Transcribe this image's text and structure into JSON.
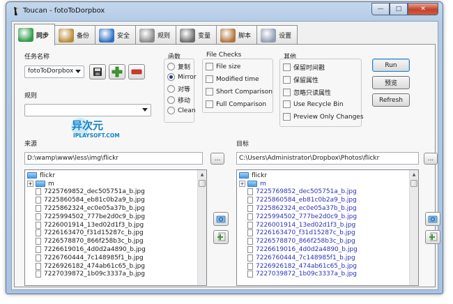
{
  "window": {
    "title": "Toucan - fotoToDorpbox"
  },
  "tabs": [
    {
      "label": "同步",
      "icon": "sync-icon",
      "active": true
    },
    {
      "label": "备份",
      "icon": "backup-box-icon",
      "active": false
    },
    {
      "label": "安全",
      "icon": "security-globe-icon",
      "active": false
    },
    {
      "label": "规则",
      "icon": "rules-document-icon",
      "active": false
    },
    {
      "label": "变量",
      "icon": "variables-tools-icon",
      "active": false
    },
    {
      "label": "脚本",
      "icon": "script-scroll-icon",
      "active": false
    },
    {
      "label": "设置",
      "icon": "settings-gear-icon",
      "active": false
    }
  ],
  "task": {
    "label": "任务名称",
    "value": "fotoToDorpbox"
  },
  "rules": {
    "label": "规则",
    "value": ""
  },
  "function": {
    "label": "函数",
    "options": [
      {
        "label": "复制",
        "selected": false
      },
      {
        "label": "Mirror",
        "selected": true
      },
      {
        "label": "对等",
        "selected": false
      },
      {
        "label": "移动",
        "selected": false
      },
      {
        "label": "Clean",
        "selected": false
      }
    ]
  },
  "file_checks": {
    "label": "File Checks",
    "options": [
      {
        "label": "File size",
        "checked": false
      },
      {
        "label": "Modified time",
        "checked": false
      },
      {
        "label": "Short Comparison",
        "checked": false
      },
      {
        "label": "Full Comparison",
        "checked": false
      }
    ]
  },
  "other": {
    "label": "其他",
    "options": [
      {
        "label": "保留时间戳",
        "checked": false
      },
      {
        "label": "保留属性",
        "checked": false
      },
      {
        "label": "忽略只读属性",
        "checked": false
      },
      {
        "label": "Use Recycle Bin",
        "checked": false
      },
      {
        "label": "Preview Only Changes",
        "checked": false
      }
    ]
  },
  "buttons": {
    "run": "Run",
    "preview": "预览",
    "refresh": "Refresh",
    "browse": "..."
  },
  "source": {
    "label": "来源",
    "path": "D:\\wamp\\www\\less\\img\\flickr",
    "tree": {
      "root": "flickr",
      "folder": "m",
      "files": [
        "7225769852_dec505751a_b.jpg",
        "7225860584_eb81c0b2a9_b.jpg",
        "7225862324_ec0e05a37b_b.jpg",
        "7225994502_777be2d0c9_b.jpg",
        "7226001914_13ed02d1f3_b.jpg",
        "7226163470_f31d15287c_b.jpg",
        "7226578870_866f258b3c_b.jpg",
        "7226619016_4d0d2a4890_b.jpg",
        "7226760444_7c148985f1_b.jpg",
        "7226926182_474ab61c65_b.jpg",
        "7227039872_1b09c3337a_b.jpg"
      ]
    }
  },
  "target": {
    "label": "目标",
    "path": "C:\\Users\\Administrator\\Dropbox\\Photos\\flickr",
    "tree": {
      "root": "flickr",
      "folder": "m",
      "files": [
        "7225769852_dec505751a_b.jpg",
        "7225860584_eb81c0b2a9_b.jpg",
        "7225862324_ec0e05a37b_b.jpg",
        "7225994502_777be2d0c9_b.jpg",
        "7226001914_13ed02d1f3_b.jpg",
        "7226163470_f31d15287c_b.jpg",
        "7226578870_866f258b3c_b.jpg",
        "7226619016_4d0d2a4890_b.jpg",
        "7226760444_7c148985f1_b.jpg",
        "7226926182_474ab61c65_b.jpg",
        "7227039872_1b09c3337a_b.jpg"
      ]
    }
  },
  "watermark": {
    "main": "异次元",
    "sub": "IPLAYSOFT.COM"
  },
  "colors": {
    "accent": "#2733b5",
    "frame": "#b3cbe6",
    "add": "#3c9a2e",
    "remove": "#d2382a"
  }
}
